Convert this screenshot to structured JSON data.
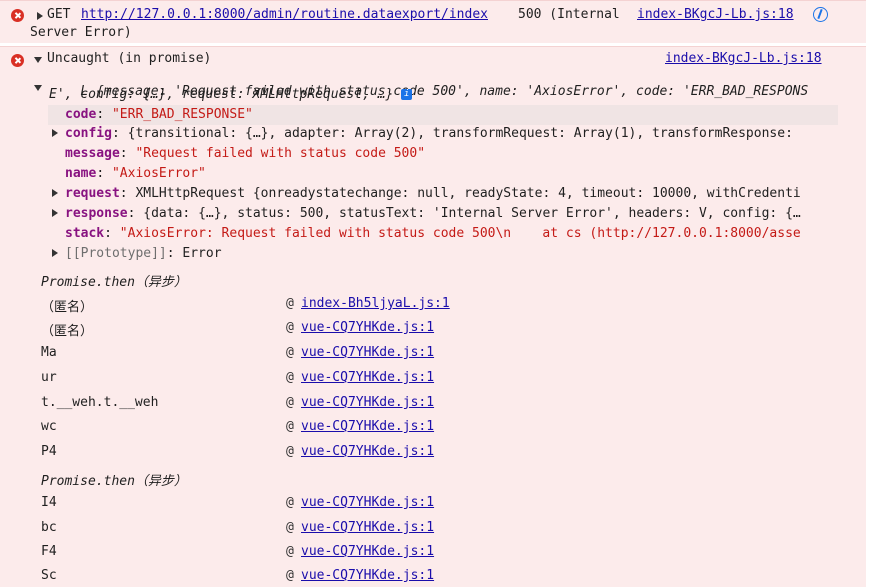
{
  "msg1": {
    "method": "GET",
    "url": "http://127.0.0.1:8000/admin/routine.dataexport/index",
    "status": "500 (Internal",
    "status_cont": "Server Error)",
    "source": "index-BKgcJ-Lb.js:18"
  },
  "msg2": {
    "title": "Uncaught (in promise)",
    "source": "index-BKgcJ-Lb.js:18",
    "summary_l1": "L {message: 'Request failed with status code 500', name: 'AxiosError', code: 'ERR_BAD_RESPONS",
    "summary_l2": "E', config: {…}, request: XMLHttpRequest, …}",
    "info_badge": "i",
    "props": [
      {
        "key": "code",
        "value": "\"ERR_BAD_RESPONSE\""
      },
      {
        "key": "config",
        "value": "{transitional: {…}, adapter: Array(2), transformRequest: Array(1), transformResponse:"
      },
      {
        "key": "message",
        "value": "\"Request failed with status code 500\""
      },
      {
        "key": "name",
        "value": "\"AxiosError\""
      },
      {
        "key": "request",
        "value": "XMLHttpRequest {onreadystatechange: null, readyState: 4, timeout: 10000, withCredenti"
      },
      {
        "key": "response",
        "value": "{data: {…}, status: 500, statusText: 'Internal Server Error', headers: V, config: {…"
      },
      {
        "key": "stack",
        "value": "\"AxiosError: Request failed with status code 500\\n    at cs (http://127.0.0.1:8000/asse"
      },
      {
        "key": "[[Prototype]]",
        "value": "Error"
      }
    ],
    "async1": "Promise.then（异步）",
    "frames1": [
      {
        "fn": "（匿名）",
        "at": "@",
        "src": "index-Bh5ljyaL.js:1"
      },
      {
        "fn": "（匿名）",
        "at": "@",
        "src": "vue-CQ7YHKde.js:1"
      },
      {
        "fn": "Ma",
        "at": "@",
        "src": "vue-CQ7YHKde.js:1"
      },
      {
        "fn": "ur",
        "at": "@",
        "src": "vue-CQ7YHKde.js:1"
      },
      {
        "fn": "t.__weh.t.__weh",
        "at": "@",
        "src": "vue-CQ7YHKde.js:1"
      },
      {
        "fn": "wc",
        "at": "@",
        "src": "vue-CQ7YHKde.js:1"
      },
      {
        "fn": "P4",
        "at": "@",
        "src": "vue-CQ7YHKde.js:1"
      }
    ],
    "async2": "Promise.then（异步）",
    "frames2": [
      {
        "fn": "I4",
        "at": "@",
        "src": "vue-CQ7YHKde.js:1"
      },
      {
        "fn": "bc",
        "at": "@",
        "src": "vue-CQ7YHKde.js:1"
      },
      {
        "fn": "F4",
        "at": "@",
        "src": "vue-CQ7YHKde.js:1"
      },
      {
        "fn": "Sc",
        "at": "@",
        "src": "vue-CQ7YHKde.js:1"
      }
    ]
  }
}
